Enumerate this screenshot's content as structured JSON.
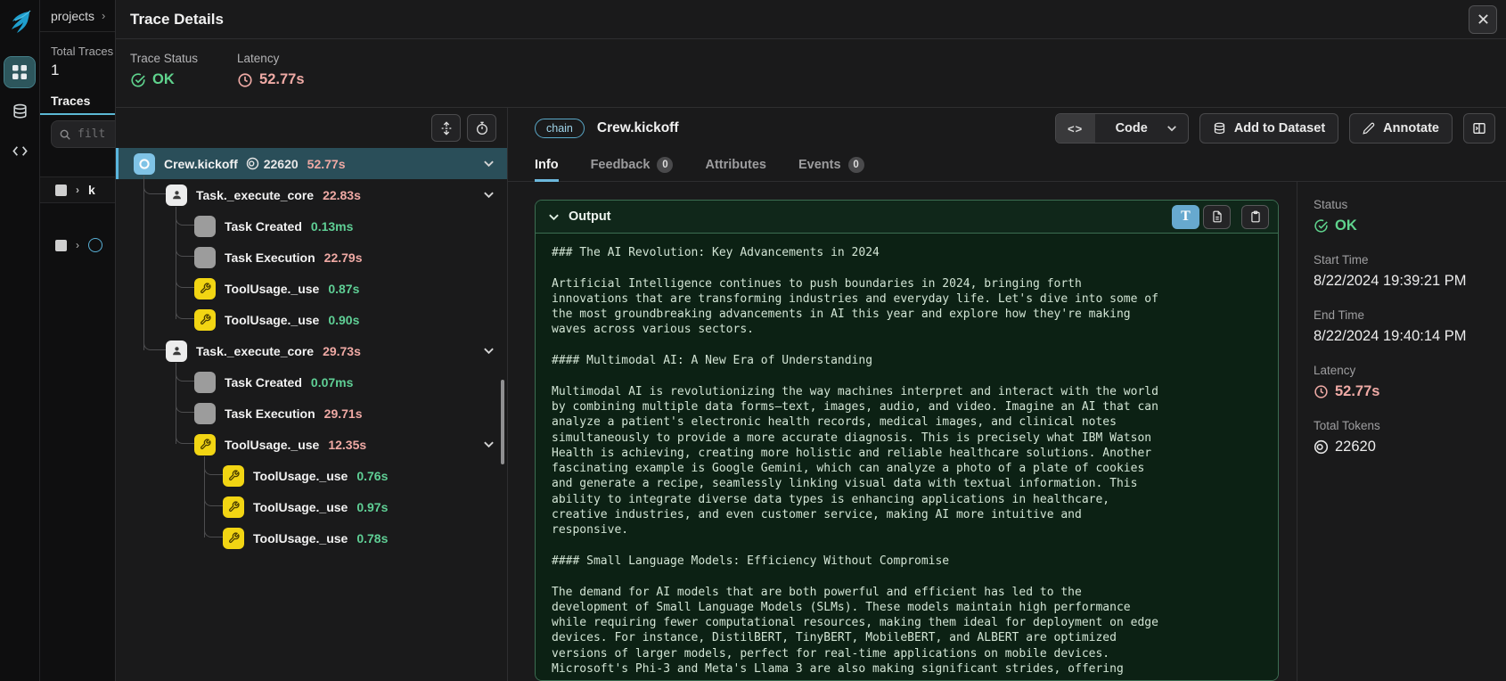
{
  "colors": {
    "accent_blue": "#5ab6de",
    "ok_green": "#5fd38d",
    "latency_pink": "#efaaa5",
    "tool_yellow": "#f2d513",
    "selected_row_bg": "#2a4e59",
    "output_green_bg": "#0c2114",
    "output_border": "#3c6e52"
  },
  "left_rail": {
    "icons": [
      "phoenix-logo",
      "projects-grid-icon",
      "datasets-database-icon",
      "code-icon"
    ],
    "active_icon": "projects-grid-icon"
  },
  "projects_page": {
    "breadcrumb": "projects",
    "total_traces_label": "Total Traces",
    "total_traces_value": "1",
    "traces_tab_label": "Traces",
    "filter_placeholder": "filt",
    "table_header_partial": "k"
  },
  "dialog": {
    "title": "Trace Details",
    "summary": {
      "trace_status_label": "Trace Status",
      "trace_status_value": "OK",
      "latency_label": "Latency",
      "latency_value": "52.77s"
    },
    "tree": {
      "items": [
        {
          "name": "Crew.kickoff",
          "icon": "chain-icon",
          "level": 0,
          "selected": true,
          "tokens": "22620",
          "duration": "52.77s",
          "duration_color": "pink",
          "expandable": true
        },
        {
          "name": "Task._execute_core",
          "icon": "agent-icon",
          "level": 1,
          "duration": "22.83s",
          "duration_color": "pink",
          "expandable": true
        },
        {
          "name": "Task Created",
          "icon": "event-icon",
          "level": 2,
          "duration": "0.13ms",
          "duration_color": "green"
        },
        {
          "name": "Task Execution",
          "icon": "event-icon",
          "level": 2,
          "duration": "22.79s",
          "duration_color": "pink"
        },
        {
          "name": "ToolUsage._use",
          "icon": "tool-icon",
          "level": 2,
          "duration": "0.87s",
          "duration_color": "green"
        },
        {
          "name": "ToolUsage._use",
          "icon": "tool-icon",
          "level": 2,
          "duration": "0.90s",
          "duration_color": "green"
        },
        {
          "name": "Task._execute_core",
          "icon": "agent-icon",
          "level": 1,
          "duration": "29.73s",
          "duration_color": "pink",
          "expandable": true
        },
        {
          "name": "Task Created",
          "icon": "event-icon",
          "level": 2,
          "duration": "0.07ms",
          "duration_color": "green"
        },
        {
          "name": "Task Execution",
          "icon": "event-icon",
          "level": 2,
          "duration": "29.71s",
          "duration_color": "pink"
        },
        {
          "name": "ToolUsage._use",
          "icon": "tool-icon",
          "level": 2,
          "duration": "12.35s",
          "duration_color": "pink",
          "expandable": true
        },
        {
          "name": "ToolUsage._use",
          "icon": "tool-icon",
          "level": 3,
          "duration": "0.76s",
          "duration_color": "green"
        },
        {
          "name": "ToolUsage._use",
          "icon": "tool-icon",
          "level": 3,
          "duration": "0.97s",
          "duration_color": "green"
        },
        {
          "name": "ToolUsage._use",
          "icon": "tool-icon",
          "level": 3,
          "duration": "0.78s",
          "duration_color": "green"
        }
      ]
    },
    "span_panel": {
      "kind_badge": "chain",
      "title": "Crew.kickoff",
      "actions": {
        "code_label": "Code",
        "add_to_dataset_label": "Add to Dataset",
        "annotate_label": "Annotate"
      },
      "tabs": [
        {
          "label": "Info",
          "active": true
        },
        {
          "label": "Feedback",
          "badge": "0"
        },
        {
          "label": "Attributes"
        },
        {
          "label": "Events",
          "badge": "0"
        }
      ],
      "output": {
        "title": "Output",
        "content": "### The AI Revolution: Key Advancements in 2024\n\nArtificial Intelligence continues to push boundaries in 2024, bringing forth\ninnovations that are transforming industries and everyday life. Let's dive into some of\nthe most groundbreaking advancements in AI this year and explore how they're making\nwaves across various sectors.\n\n#### Multimodal AI: A New Era of Understanding\n\nMultimodal AI is revolutionizing the way machines interpret and interact with the world\nby combining multiple data forms—text, images, audio, and video. Imagine an AI that can\nanalyze a patient's electronic health records, medical images, and clinical notes\nsimultaneously to provide a more accurate diagnosis. This is precisely what IBM Watson\nHealth is achieving, creating more holistic and reliable healthcare solutions. Another\nfascinating example is Google Gemini, which can analyze a photo of a plate of cookies\nand generate a recipe, seamlessly linking visual data with textual information. This\nability to integrate diverse data types is enhancing applications in healthcare,\ncreative industries, and even customer service, making AI more intuitive and\nresponsive.\n\n#### Small Language Models: Efficiency Without Compromise\n\nThe demand for AI models that are both powerful and efficient has led to the\ndevelopment of Small Language Models (SLMs). These models maintain high performance\nwhile requiring fewer computational resources, making them ideal for deployment on edge\ndevices. For instance, DistilBERT, TinyBERT, MobileBERT, and ALBERT are optimized\nversions of larger models, perfect for real-time applications on mobile devices.\nMicrosoft's Phi-3 and Meta's Llama 3 are also making significant strides, offering"
      },
      "details": {
        "status_label": "Status",
        "status_value": "OK",
        "start_label": "Start Time",
        "start_value": "8/22/2024 19:39:21 PM",
        "end_label": "End Time",
        "end_value": "8/22/2024 19:40:14 PM",
        "latency_label": "Latency",
        "latency_value": "52.77s",
        "tokens_label": "Total Tokens",
        "tokens_value": "22620"
      }
    }
  }
}
